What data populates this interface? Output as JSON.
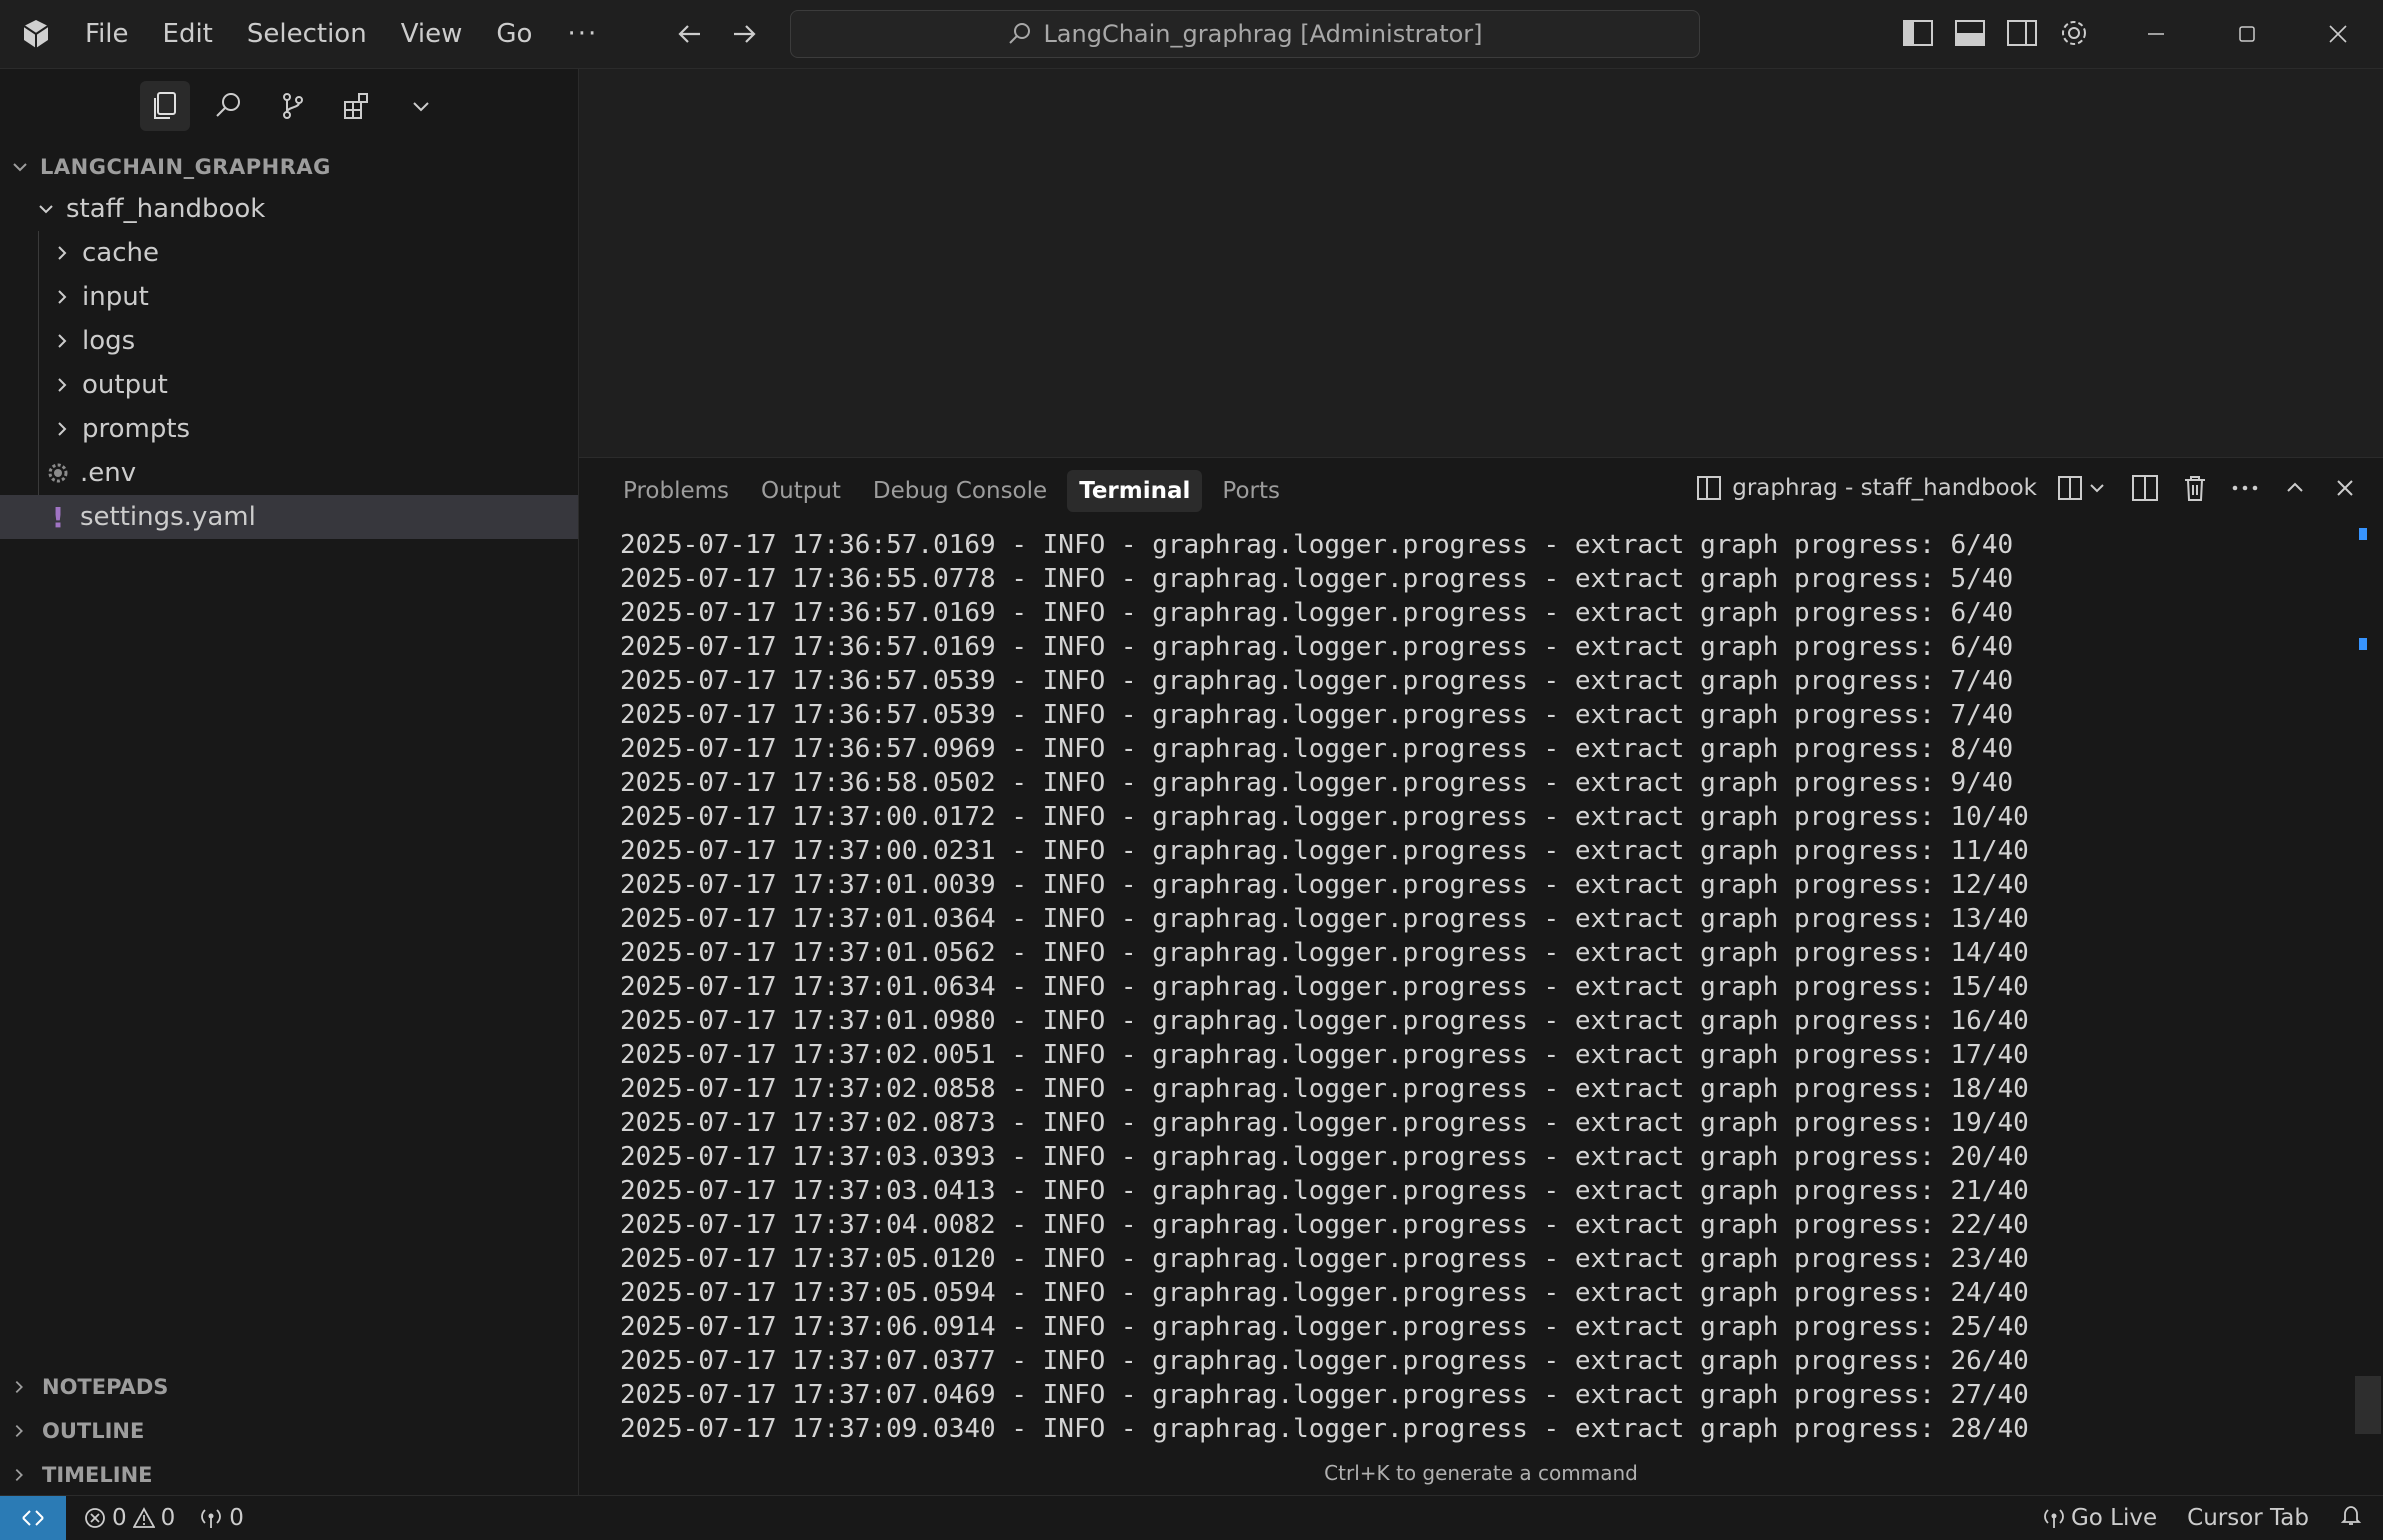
{
  "menu": [
    "File",
    "Edit",
    "Selection",
    "View",
    "Go"
  ],
  "menu_more": "···",
  "command_center": "LangChain_graphrag [Administrator]",
  "explorer": {
    "root": "LANGCHAIN_GRAPHRAG",
    "folder": "staff_handbook",
    "items": [
      {
        "label": "cache",
        "type": "folder"
      },
      {
        "label": "input",
        "type": "folder"
      },
      {
        "label": "logs",
        "type": "folder"
      },
      {
        "label": "output",
        "type": "folder"
      },
      {
        "label": "prompts",
        "type": "folder"
      },
      {
        "label": ".env",
        "type": "file-gear"
      },
      {
        "label": "settings.yaml",
        "type": "file-yaml"
      }
    ],
    "sections": [
      "NOTEPADS",
      "OUTLINE",
      "TIMELINE"
    ]
  },
  "panel": {
    "tabs": [
      "Problems",
      "Output",
      "Debug Console",
      "Terminal",
      "Ports"
    ],
    "active_tab": "Terminal",
    "terminal_name": "graphrag - staff_handbook",
    "hint": "Ctrl+K to generate a command"
  },
  "terminal_lines": [
    "2025-07-17 17:36:57.0169 - INFO - graphrag.logger.progress - extract graph progress: 6/40",
    "2025-07-17 17:36:55.0778 - INFO - graphrag.logger.progress - extract graph progress: 5/40",
    "2025-07-17 17:36:57.0169 - INFO - graphrag.logger.progress - extract graph progress: 6/40",
    "2025-07-17 17:36:57.0169 - INFO - graphrag.logger.progress - extract graph progress: 6/40",
    "2025-07-17 17:36:57.0539 - INFO - graphrag.logger.progress - extract graph progress: 7/40",
    "2025-07-17 17:36:57.0539 - INFO - graphrag.logger.progress - extract graph progress: 7/40",
    "2025-07-17 17:36:57.0969 - INFO - graphrag.logger.progress - extract graph progress: 8/40",
    "2025-07-17 17:36:58.0502 - INFO - graphrag.logger.progress - extract graph progress: 9/40",
    "2025-07-17 17:37:00.0172 - INFO - graphrag.logger.progress - extract graph progress: 10/40",
    "2025-07-17 17:37:00.0231 - INFO - graphrag.logger.progress - extract graph progress: 11/40",
    "2025-07-17 17:37:01.0039 - INFO - graphrag.logger.progress - extract graph progress: 12/40",
    "2025-07-17 17:37:01.0364 - INFO - graphrag.logger.progress - extract graph progress: 13/40",
    "2025-07-17 17:37:01.0562 - INFO - graphrag.logger.progress - extract graph progress: 14/40",
    "2025-07-17 17:37:01.0634 - INFO - graphrag.logger.progress - extract graph progress: 15/40",
    "2025-07-17 17:37:01.0980 - INFO - graphrag.logger.progress - extract graph progress: 16/40",
    "2025-07-17 17:37:02.0051 - INFO - graphrag.logger.progress - extract graph progress: 17/40",
    "2025-07-17 17:37:02.0858 - INFO - graphrag.logger.progress - extract graph progress: 18/40",
    "2025-07-17 17:37:02.0873 - INFO - graphrag.logger.progress - extract graph progress: 19/40",
    "2025-07-17 17:37:03.0393 - INFO - graphrag.logger.progress - extract graph progress: 20/40",
    "2025-07-17 17:37:03.0413 - INFO - graphrag.logger.progress - extract graph progress: 21/40",
    "2025-07-17 17:37:04.0082 - INFO - graphrag.logger.progress - extract graph progress: 22/40",
    "2025-07-17 17:37:05.0120 - INFO - graphrag.logger.progress - extract graph progress: 23/40",
    "2025-07-17 17:37:05.0594 - INFO - graphrag.logger.progress - extract graph progress: 24/40",
    "2025-07-17 17:37:06.0914 - INFO - graphrag.logger.progress - extract graph progress: 25/40",
    "2025-07-17 17:37:07.0377 - INFO - graphrag.logger.progress - extract graph progress: 26/40",
    "2025-07-17 17:37:07.0469 - INFO - graphrag.logger.progress - extract graph progress: 27/40",
    "2025-07-17 17:37:09.0340 - INFO - graphrag.logger.progress - extract graph progress: 28/40"
  ],
  "status": {
    "errors": "0",
    "warnings": "0",
    "ports": "0",
    "go_live": "Go Live",
    "cursor_tab": "Cursor Tab"
  },
  "colors": {
    "accent": "#2b7bb5",
    "background": "#181818",
    "editor": "#1f1f1f",
    "yaml_icon": "#a074c4"
  }
}
